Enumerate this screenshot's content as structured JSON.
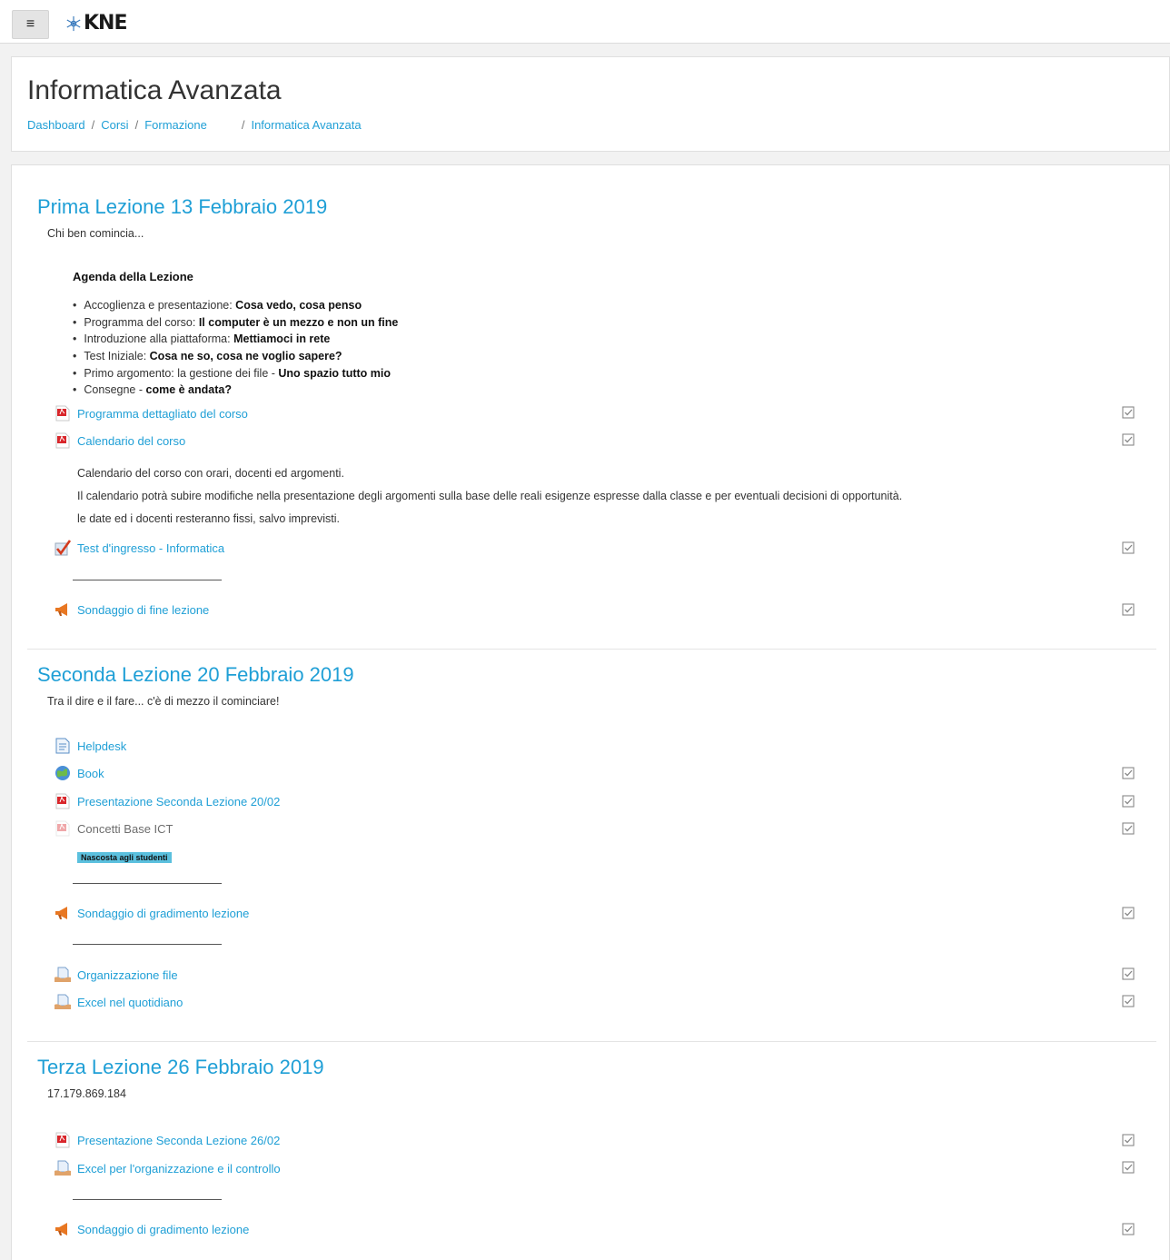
{
  "navbar": {
    "menu_glyph": "≡",
    "brand": "KNE"
  },
  "header": {
    "title": "Informatica Avanzata",
    "breadcrumb": [
      "Dashboard",
      "Corsi",
      "Formazione",
      "Informatica Avanzata"
    ]
  },
  "sections": [
    {
      "title": "Prima Lezione 13 Febbraio 2019",
      "summary": "Chi ben comincia...",
      "agenda_title": "Agenda della Lezione",
      "agenda": [
        {
          "text": "Accoglienza e presentazione: ",
          "bold": "Cosa vedo, cosa penso"
        },
        {
          "text": "Programma del corso: ",
          "bold": "Il computer è un mezzo e non un fine"
        },
        {
          "text": "Introduzione alla piattaforma: ",
          "bold": "Mettiamoci in rete"
        },
        {
          "text": "Test Iniziale: ",
          "bold": "Cosa ne so, cosa ne voglio sapere?"
        },
        {
          "text": "Primo argomento: la gestione dei file - ",
          "bold": "Uno spazio tutto mio"
        },
        {
          "text": "Consegne - ",
          "bold": "come è andata?"
        }
      ],
      "activities": [
        {
          "label": "Programma dettagliato del corso",
          "icon": "pdf-icon"
        },
        {
          "label": "Calendario del corso",
          "icon": "pdf-icon"
        },
        {
          "label": "Test d'ingresso - Informatica",
          "icon": "quiz-icon"
        },
        {
          "label": "Sondaggio di fine lezione",
          "icon": "feedback-icon"
        }
      ],
      "calendar_desc": [
        "Calendario del corso con orari, docenti ed argomenti.",
        "Il calendario potrà subire modifiche nella presentazione degli argomenti sulla base delle reali esigenze espresse dalla classe e per eventuali decisioni di opportunità.",
        "le date ed i docenti resteranno fissi, salvo imprevisti."
      ]
    },
    {
      "title": "Seconda Lezione 20 Febbraio 2019",
      "summary": "Tra il dire e il fare... c'è di mezzo il cominciare!",
      "activities": [
        {
          "label": "Helpdesk",
          "icon": "page-icon"
        },
        {
          "label": "Book",
          "icon": "book-icon"
        },
        {
          "label": "Presentazione Seconda Lezione 20/02",
          "icon": "pdf-icon"
        },
        {
          "label": "Concetti Base ICT",
          "icon": "pdf-icon"
        },
        {
          "label": "Sondaggio di gradimento lezione",
          "icon": "feedback-icon"
        },
        {
          "label": "Organizzazione file",
          "icon": "lesson-icon"
        },
        {
          "label": "Excel nel quotidiano",
          "icon": "lesson-icon"
        }
      ],
      "hidden_badge": "Nascosta agli studenti"
    },
    {
      "title": "Terza Lezione 26 Febbraio 2019",
      "summary": "17.179.869.184",
      "activities": [
        {
          "label": "Presentazione Seconda Lezione 26/02",
          "icon": "pdf-icon"
        },
        {
          "label": "Excel per l'organizzazione e il controllo",
          "icon": "lesson-icon"
        },
        {
          "label": "Sondaggio di gradimento lezione",
          "icon": "feedback-icon"
        }
      ]
    }
  ],
  "colors": {
    "link": "#1f9fd6",
    "badge": "#5bc0de",
    "pdf": "#d9262b",
    "feedback": "#e87722"
  }
}
